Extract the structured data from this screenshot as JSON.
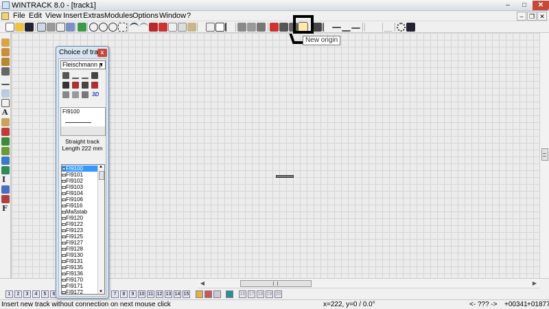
{
  "window": {
    "title": "WINTRACK 8.0 - [track1]",
    "minimize": "–",
    "maximize": "□",
    "close": "✕"
  },
  "menu": [
    "File",
    "Edit",
    "View",
    "Insert",
    "Extras",
    "Modules",
    "Options",
    "Window",
    "?"
  ],
  "mdi_controls": {
    "minimize": "–",
    "restore": "❐",
    "close": "✕"
  },
  "tooltip": "New origin",
  "palette": {
    "title": "Choice of tra...",
    "close": "x",
    "manufacturer": "Fleischmann p",
    "dropdown_arrow": "▼",
    "label_3d": "3D",
    "preview_name": "FI9100",
    "desc_line1": "Straight track",
    "desc_line2": "Length 222 mm",
    "tracks": [
      "FI9100",
      "FI9101",
      "FI9102",
      "FI9103",
      "FI9104",
      "FI9106",
      "FI9116",
      "Maßstab",
      "FI9120",
      "FI9122",
      "FI9123",
      "FI9125",
      "FI9127",
      "FI9128",
      "FI9130",
      "FI9131",
      "FI9135",
      "FI9136",
      "FI9170",
      "FI9171",
      "FI9172"
    ],
    "selected_index": 0
  },
  "layer_tabs": [
    "1",
    "2",
    "3",
    "4",
    "5",
    "6",
    "7",
    "8",
    "9",
    "10",
    "11",
    "12",
    "13",
    "14",
    "15",
    "16",
    "17",
    "18",
    "19",
    "20"
  ],
  "status": {
    "hint": "Insert new track without connection on next mouse click",
    "coords": "x=222, y=0 / 0.0°",
    "nav": "<- ??? ->",
    "pos_x": "+00341",
    "pos_y": "+01877"
  },
  "icons": {
    "toolbar": [
      "new-file-icon",
      "open-folder-icon",
      "save-icon",
      "print-preview-icon",
      "print-icon",
      "copy-page-icon",
      "page-icon",
      "export-image-icon",
      "zoom-out-icon",
      "zoom-in-icon",
      "zoom-fit-icon",
      "zoom-window-icon",
      "undo-icon",
      "redo-icon",
      "red-book-icon",
      "red-list-icon",
      "cut-icon",
      "copy-icon",
      "paste-icon",
      "filter-icon",
      "select-icon",
      "curve-icon",
      "track-group-icon",
      "track-join-icon",
      "track-split-icon",
      "red-cross-icon",
      "building-icon",
      "track-piece-icon",
      "new-origin-icon",
      "signal-icon",
      "switch-icon",
      "crossing-icon",
      "track-line-icon",
      "bridge-icon",
      "align-left-icon",
      "align-right-icon",
      "align-center-icon",
      "gear-icon",
      "help-icon"
    ]
  },
  "colors": {
    "selection": "#3399ff",
    "close_button": "#c7473b",
    "grid_line": "#d5d5d5"
  }
}
